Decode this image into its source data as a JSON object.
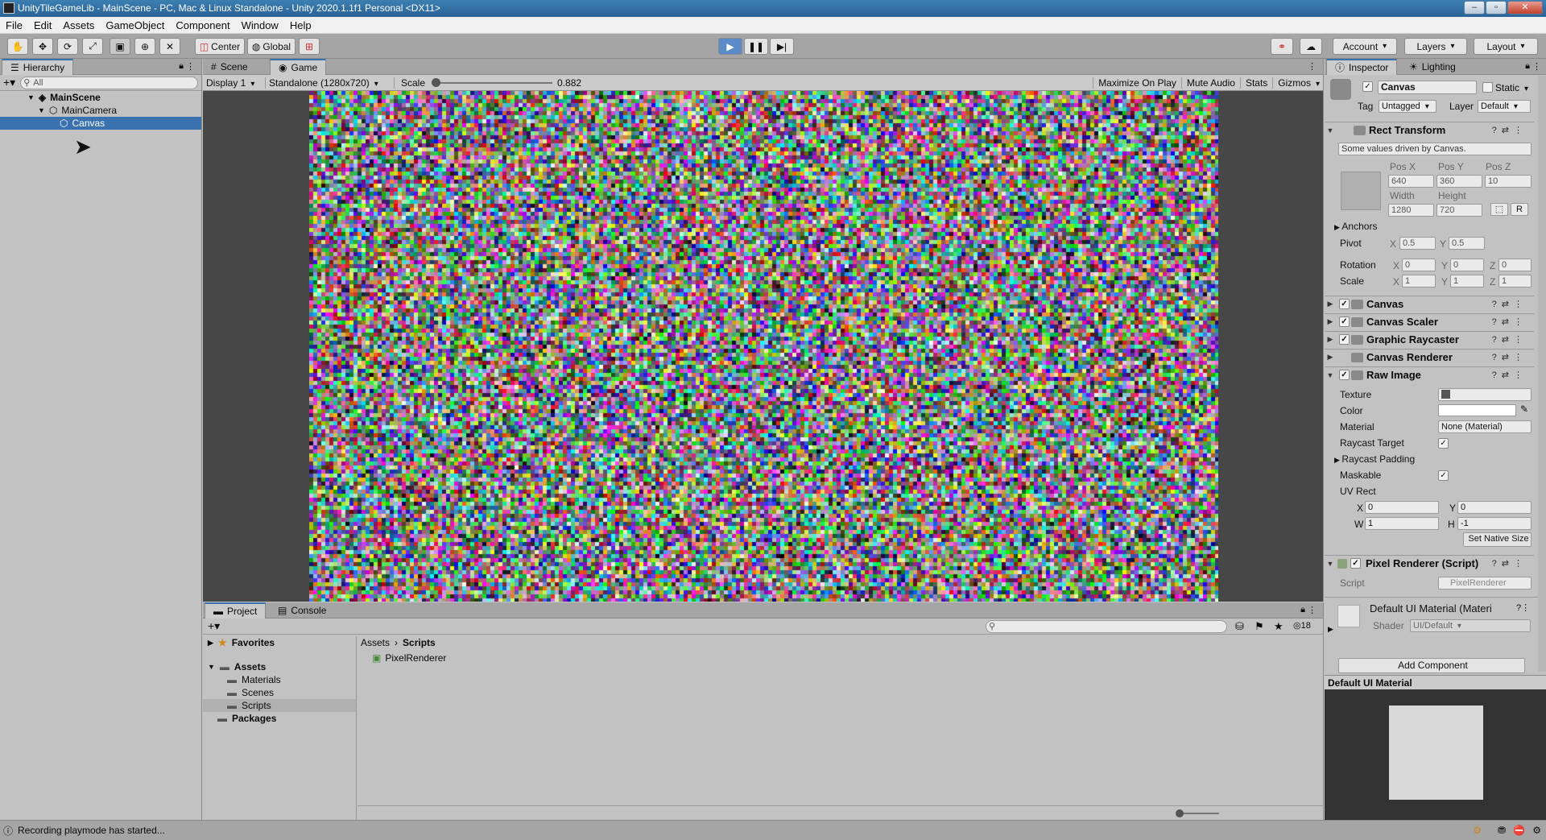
{
  "window": {
    "title": "UnityTileGameLib - MainScene - PC, Mac & Linux Standalone - Unity 2020.1.1f1 Personal <DX11>"
  },
  "menu": [
    "File",
    "Edit",
    "Assets",
    "GameObject",
    "Component",
    "Window",
    "Help"
  ],
  "toolbar": {
    "pivot": "Center",
    "space": "Global",
    "account": "Account",
    "layers": "Layers",
    "layout": "Layout"
  },
  "hierarchy": {
    "tab": "Hierarchy",
    "search_placeholder": "All",
    "items": [
      {
        "label": "MainScene"
      },
      {
        "label": "MainCamera"
      },
      {
        "label": "Canvas"
      }
    ]
  },
  "scene_tabs": {
    "scene": "Scene",
    "game": "Game"
  },
  "game_bar": {
    "display": "Display 1",
    "resolution": "Standalone (1280x720)",
    "scale_label": "Scale",
    "scale_value": "0.882",
    "scale_fraction": 0.0,
    "maximize": "Maximize On Play",
    "mute": "Mute Audio",
    "stats": "Stats",
    "gizmos": "Gizmos"
  },
  "project": {
    "tabs": {
      "project": "Project",
      "console": "Console"
    },
    "favorites": "Favorites",
    "assets": "Assets",
    "folders": [
      "Materials",
      "Scenes",
      "Scripts"
    ],
    "packages": "Packages",
    "breadcrumb": {
      "root": "Assets",
      "current": "Scripts"
    },
    "files": [
      "PixelRenderer"
    ],
    "hidden_count": "18"
  },
  "status": {
    "message": "Recording playmode has started..."
  },
  "inspector": {
    "tabs": {
      "inspector": "Inspector",
      "lighting": "Lighting"
    },
    "object_name": "Canvas",
    "static_label": "Static",
    "tag_label": "Tag",
    "tag_value": "Untagged",
    "layer_label": "Layer",
    "layer_value": "Default",
    "rect": {
      "title": "Rect Transform",
      "note": "Some values driven by Canvas.",
      "posx_label": "Pos X",
      "posy_label": "Pos Y",
      "posz_label": "Pos Z",
      "posx": "640",
      "posy": "360",
      "posz": "10",
      "width_label": "Width",
      "height_label": "Height",
      "width": "1280",
      "height": "720",
      "r_button": "R",
      "anchors": "Anchors",
      "pivot_label": "Pivot",
      "pivot_x": "0.5",
      "pivot_y": "0.5",
      "rotation_label": "Rotation",
      "rot_x": "0",
      "rot_y": "0",
      "rot_z": "0",
      "scale_label": "Scale",
      "scale_x": "1",
      "scale_y": "1",
      "scale_z": "1",
      "x": "X",
      "y": "Y",
      "z": "Z"
    },
    "components": [
      "Canvas",
      "Canvas Scaler",
      "Graphic Raycaster",
      "Canvas Renderer"
    ],
    "raw_image": {
      "title": "Raw Image",
      "texture": "Texture",
      "color": "Color",
      "material": "Material",
      "material_value": "None (Material)",
      "raycast_target": "Raycast Target",
      "raycast_padding": "Raycast Padding",
      "maskable": "Maskable",
      "uv_rect": "UV Rect",
      "uv_x_label": "X",
      "uv_y_label": "Y",
      "uv_w_label": "W",
      "uv_h_label": "H",
      "uv_x": "0",
      "uv_y": "0",
      "uv_w": "1",
      "uv_h": "-1",
      "native_size": "Set Native Size"
    },
    "pixel_renderer": {
      "title": "Pixel Renderer (Script)",
      "script_label": "Script",
      "script_value": "PixelRenderer"
    },
    "material": {
      "name": "Default UI Material (Materi",
      "shader_label": "Shader",
      "shader_value": "UI/Default"
    },
    "add_component": "Add Component",
    "preview_title": "Default UI Material"
  }
}
